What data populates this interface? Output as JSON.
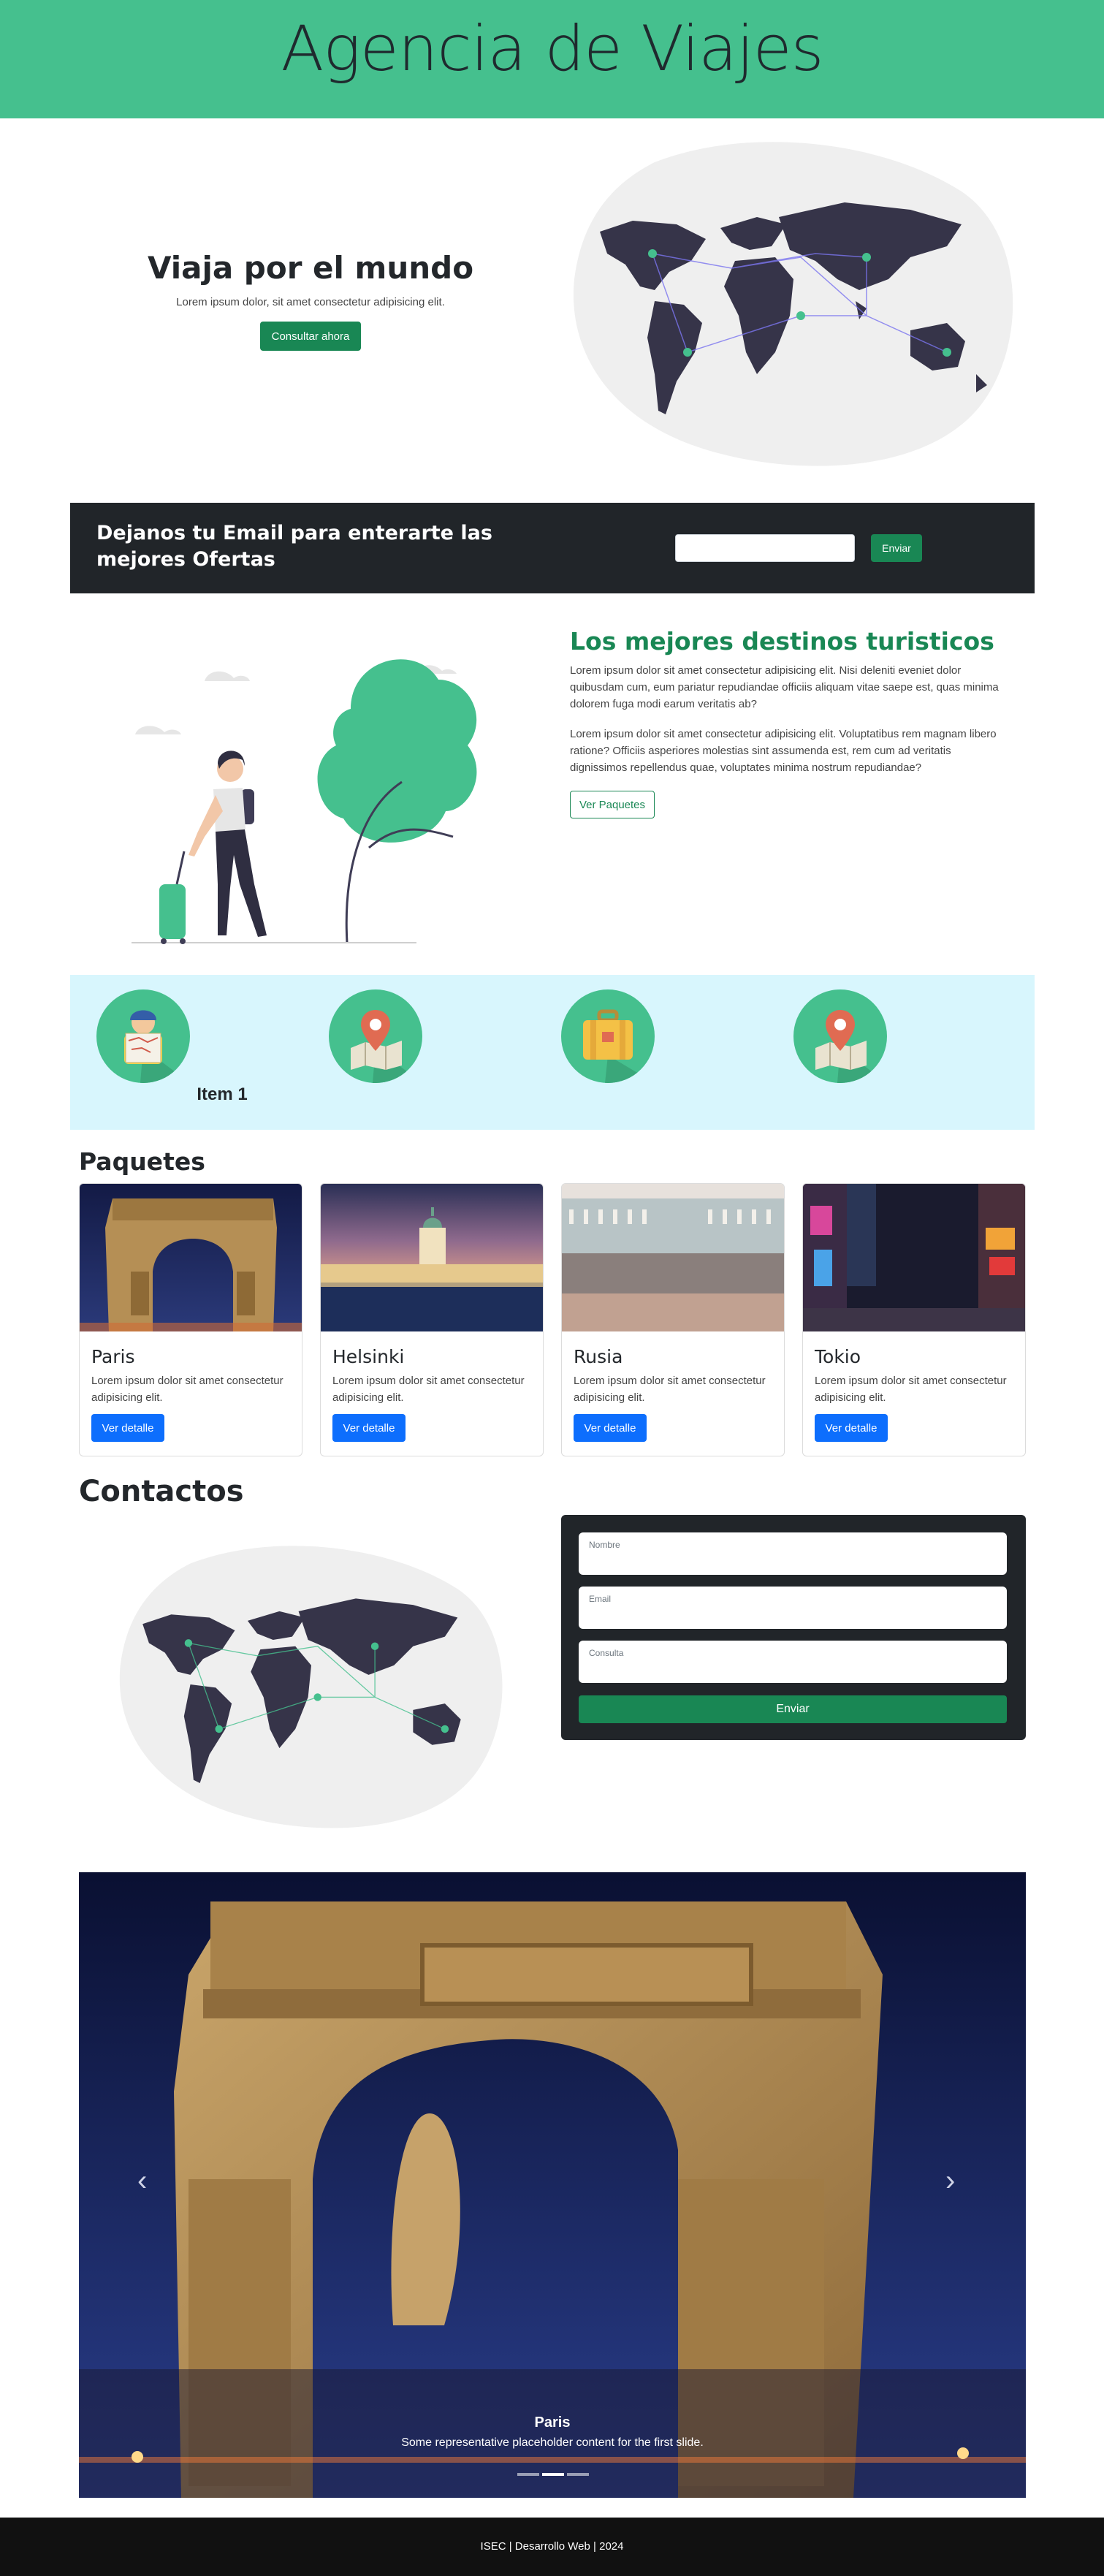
{
  "header": {
    "title": "Agencia de Viajes"
  },
  "hero": {
    "title": "Viaja por el mundo",
    "text": "Lorem ipsum dolor, sit amet consectetur adipisicing elit.",
    "button": "Consultar ahora"
  },
  "newsletter": {
    "title": "Dejanos tu Email para enterarte las mejores Ofertas",
    "input_value": "",
    "button": "Enviar"
  },
  "destinos": {
    "title": "Los mejores destinos turisticos",
    "p1": "Lorem ipsum dolor sit amet consectetur adipisicing elit. Nisi deleniti eveniet dolor quibusdam cum, eum pariatur repudiandae officiis aliquam vitae saepe est, quas minima dolorem fuga modi earum veritatis ab?",
    "p2": "Lorem ipsum dolor sit amet consectetur adipisicing elit. Voluptatibus rem magnam libero ratione? Officiis asperiores molestias sint assumenda est, rem cum ad veritatis dignissimos repellendus quae, voluptates minima nostrum repudiandae?",
    "button": "Ver Paquetes"
  },
  "iconband": {
    "label": "Item 1",
    "icons": [
      "traveler-map-icon",
      "map-pin-icon",
      "suitcase-icon",
      "map-pin-icon"
    ]
  },
  "paquetes": {
    "title": "Paquetes",
    "cards": [
      {
        "name": "Paris",
        "text": "Lorem ipsum dolor sit amet consectetur adipisicing elit.",
        "button": "Ver detalle"
      },
      {
        "name": "Helsinki",
        "text": "Lorem ipsum dolor sit amet consectetur adipisicing elit.",
        "button": "Ver detalle"
      },
      {
        "name": "Rusia",
        "text": "Lorem ipsum dolor sit amet consectetur adipisicing elit.",
        "button": "Ver detalle"
      },
      {
        "name": "Tokio",
        "text": "Lorem ipsum dolor sit amet consectetur adipisicing elit.",
        "button": "Ver detalle"
      }
    ]
  },
  "contactos": {
    "title": "Contactos",
    "fields": [
      "Nombre",
      "Email",
      "Consulta"
    ],
    "button": "Enviar"
  },
  "carousel": {
    "caption_title": "Paris",
    "caption_text": "Some representative placeholder content for the first slide.",
    "prev_symbol": "‹",
    "next_symbol": "›",
    "slides": 3,
    "active_slide": 2
  },
  "footer": {
    "text": "ISEC | Desarrollo Web | 2024"
  },
  "colors": {
    "brand_green": "#45c08e",
    "button_green": "#198754",
    "dark": "#212529",
    "blue": "#0d6efd",
    "light_cyan": "#d8f6fd"
  }
}
